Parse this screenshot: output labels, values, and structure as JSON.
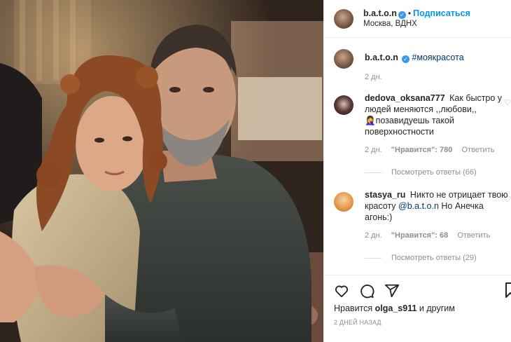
{
  "post": {
    "username": "b.a.t.o.n",
    "follow_label": "Подписаться",
    "location": "Москва, ВДНХ"
  },
  "caption": {
    "username": "b.a.t.o.n",
    "hashtag": "#моякрасота",
    "time": "2 дн."
  },
  "comments": [
    {
      "username": "dedova_oksana777",
      "text": "Как быстро у людей меняются ,,любови,, 🤦‍♀️позавидуешь такой поверхностности",
      "time": "2 дн.",
      "likes": "\"Нравится\": 780",
      "reply": "Ответить",
      "view_replies": "Посмотреть ответы (66)"
    },
    {
      "username": "stasya_ru",
      "text_before": "Никто не отрицает твою красоту ",
      "mention": "@b.a.t.o.n",
      "text_after": " Но Анечка агонь:)",
      "time": "2 дн.",
      "likes": "\"Нравится\": 68",
      "reply": "Ответить",
      "view_replies": "Посмотреть ответы (29)"
    }
  ],
  "likes_prefix": "Нравится",
  "likes_user": "olga_s911",
  "likes_suffix": "и другим",
  "time_ago": "2 дней назад",
  "colors": {
    "link": "#0095f6",
    "verified": "#3897f0",
    "muted": "#8e8e8e"
  },
  "icons": [
    "heart-icon",
    "comment-icon",
    "share-icon",
    "bookmark-icon",
    "verified-icon"
  ]
}
